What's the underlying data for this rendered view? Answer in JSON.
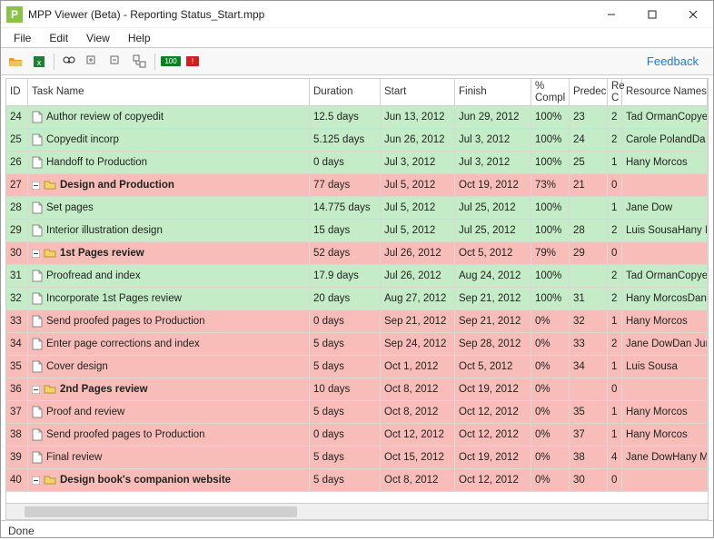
{
  "title": "MPP Viewer (Beta) - Reporting Status_Start.mpp",
  "menu": {
    "file": "File",
    "edit": "Edit",
    "view": "View",
    "help": "Help"
  },
  "toolbar": {
    "feedback": "Feedback",
    "highlight_100": "100",
    "highlight_red": "!"
  },
  "status": "Done",
  "headers": {
    "id": "ID",
    "task": "Task Name",
    "duration": "Duration",
    "start": "Start",
    "finish": "Finish",
    "pct": "% Compl",
    "pred": "Predec",
    "rc": "Re C",
    "res": "Resource Names"
  },
  "rows": [
    {
      "id": "24",
      "name": "Author review of copyedit",
      "duration": "12.5 days",
      "start": "Jun 13, 2012",
      "finish": "Jun 29, 2012",
      "pct": "100%",
      "pred": "23",
      "rc": "2",
      "res": "Tad OrmanCopye",
      "color": "green",
      "type": "leaf",
      "indent": 1
    },
    {
      "id": "25",
      "name": "Copyedit incorp",
      "duration": "5.125 days",
      "start": "Jun 26, 2012",
      "finish": "Jul 3, 2012",
      "pct": "100%",
      "pred": "24",
      "rc": "2",
      "res": "Carole PolandDa",
      "color": "green",
      "type": "leaf",
      "indent": 1
    },
    {
      "id": "26",
      "name": "Handoff to Production",
      "duration": "0 days",
      "start": "Jul 3, 2012",
      "finish": "Jul 3, 2012",
      "pct": "100%",
      "pred": "25",
      "rc": "1",
      "res": "Hany Morcos",
      "color": "green",
      "type": "leaf",
      "indent": 1
    },
    {
      "id": "27",
      "name": "Design and Production",
      "duration": "77 days",
      "start": "Jul 5, 2012",
      "finish": "Oct 19, 2012",
      "pct": "73%",
      "pred": "21",
      "rc": "0",
      "res": "",
      "color": "red",
      "type": "parent",
      "indent": 0
    },
    {
      "id": "28",
      "name": "Set pages",
      "duration": "14.775 days",
      "start": "Jul 5, 2012",
      "finish": "Jul 25, 2012",
      "pct": "100%",
      "pred": "",
      "rc": "1",
      "res": "Jane Dow",
      "color": "green",
      "type": "leaf",
      "indent": 1
    },
    {
      "id": "29",
      "name": "Interior illustration design",
      "duration": "15 days",
      "start": "Jul 5, 2012",
      "finish": "Jul 25, 2012",
      "pct": "100%",
      "pred": "28",
      "rc": "2",
      "res": "Luis SousaHany M",
      "color": "green",
      "type": "leaf",
      "indent": 1
    },
    {
      "id": "30",
      "name": "1st Pages review",
      "duration": "52 days",
      "start": "Jul 26, 2012",
      "finish": "Oct 5, 2012",
      "pct": "79%",
      "pred": "29",
      "rc": "0",
      "res": "",
      "color": "red",
      "type": "parent",
      "indent": 1
    },
    {
      "id": "31",
      "name": "Proofread and index",
      "duration": "17.9 days",
      "start": "Jul 26, 2012",
      "finish": "Aug 24, 2012",
      "pct": "100%",
      "pred": "",
      "rc": "2",
      "res": "Tad OrmanCopye",
      "color": "green",
      "type": "leaf",
      "indent": 2
    },
    {
      "id": "32",
      "name": "Incorporate 1st Pages review",
      "duration": "20 days",
      "start": "Aug 27, 2012",
      "finish": "Sep 21, 2012",
      "pct": "100%",
      "pred": "31",
      "rc": "2",
      "res": "Hany MorcosDan",
      "color": "green",
      "type": "leaf",
      "indent": 2
    },
    {
      "id": "33",
      "name": "Send proofed pages to Production",
      "duration": "0 days",
      "start": "Sep 21, 2012",
      "finish": "Sep 21, 2012",
      "pct": "0%",
      "pred": "32",
      "rc": "1",
      "res": "Hany Morcos",
      "color": "red",
      "type": "leaf",
      "indent": 2
    },
    {
      "id": "34",
      "name": "Enter page corrections and index",
      "duration": "5 days",
      "start": "Sep 24, 2012",
      "finish": "Sep 28, 2012",
      "pct": "0%",
      "pred": "33",
      "rc": "2",
      "res": "Jane DowDan Jum",
      "color": "red",
      "type": "leaf",
      "indent": 2
    },
    {
      "id": "35",
      "name": "Cover design",
      "duration": "5 days",
      "start": "Oct 1, 2012",
      "finish": "Oct 5, 2012",
      "pct": "0%",
      "pred": "34",
      "rc": "1",
      "res": "Luis Sousa",
      "color": "red",
      "type": "leaf",
      "indent": 2
    },
    {
      "id": "36",
      "name": "2nd Pages review",
      "duration": "10 days",
      "start": "Oct 8, 2012",
      "finish": "Oct 19, 2012",
      "pct": "0%",
      "pred": "",
      "rc": "0",
      "res": "",
      "color": "red",
      "type": "parent",
      "indent": 1
    },
    {
      "id": "37",
      "name": "Proof and review",
      "duration": "5 days",
      "start": "Oct 8, 2012",
      "finish": "Oct 12, 2012",
      "pct": "0%",
      "pred": "35",
      "rc": "1",
      "res": "Hany Morcos",
      "color": "red",
      "type": "leaf",
      "indent": 2
    },
    {
      "id": "38",
      "name": "Send proofed pages to Production",
      "duration": "0 days",
      "start": "Oct 12, 2012",
      "finish": "Oct 12, 2012",
      "pct": "0%",
      "pred": "37",
      "rc": "1",
      "res": "Hany Morcos",
      "color": "red",
      "type": "leaf",
      "indent": 2
    },
    {
      "id": "39",
      "name": "Final review",
      "duration": "5 days",
      "start": "Oct 15, 2012",
      "finish": "Oct 19, 2012",
      "pct": "0%",
      "pred": "38",
      "rc": "4",
      "res": "Jane DowHany Mo",
      "color": "red",
      "type": "leaf",
      "indent": 2
    },
    {
      "id": "40",
      "name": "Design book's companion website",
      "duration": "5 days",
      "start": "Oct 8, 2012",
      "finish": "Oct 12, 2012",
      "pct": "0%",
      "pred": "30",
      "rc": "0",
      "res": "",
      "color": "red",
      "type": "parent",
      "indent": 1
    }
  ]
}
